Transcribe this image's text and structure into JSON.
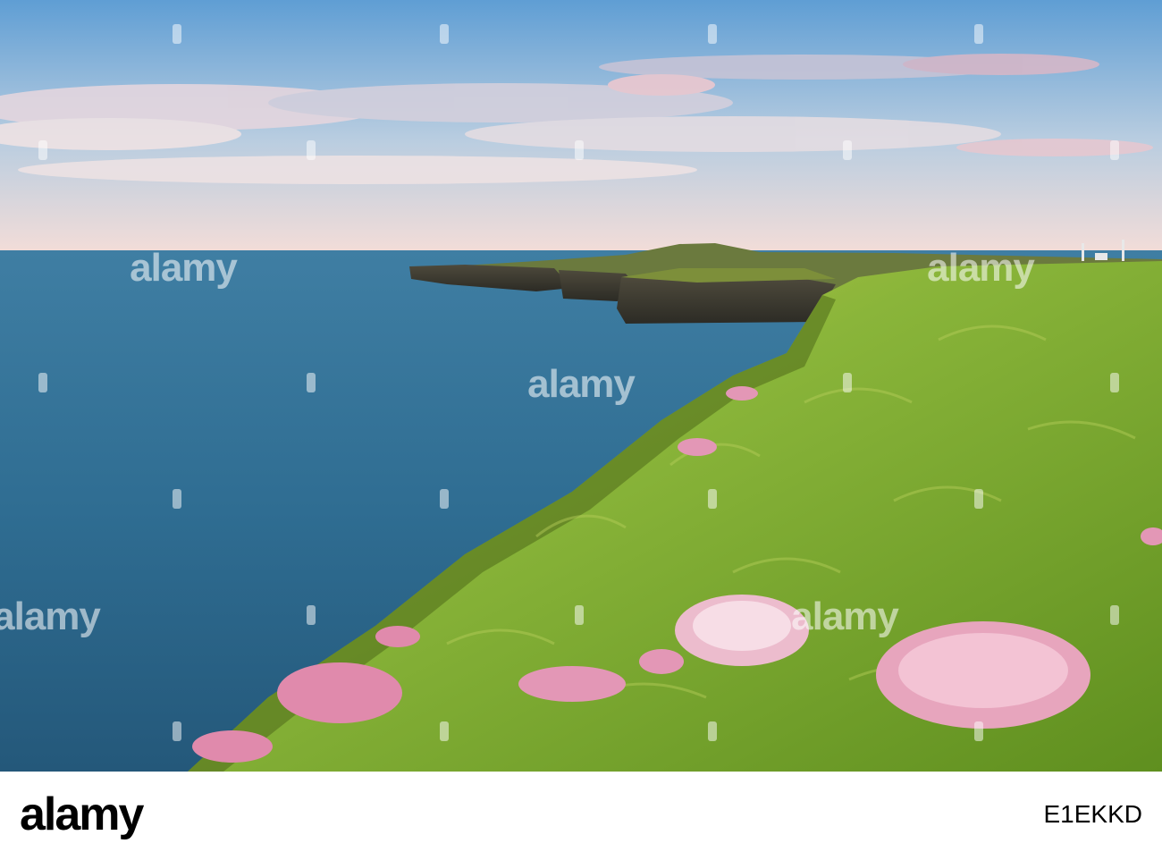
{
  "photo": {
    "subject": "coastal-cliffs",
    "colors": {
      "sky_top": "#5f9ed4",
      "sky_horizon": "#f4ddd8",
      "sea": "#2f6d92",
      "grass": "#7fae2e",
      "flowers": "#f0a9c4"
    }
  },
  "watermark": {
    "text": "alamy"
  },
  "footer": {
    "logo": "alamy",
    "image_id": "E1EKKD",
    "background": "#ffffff"
  }
}
